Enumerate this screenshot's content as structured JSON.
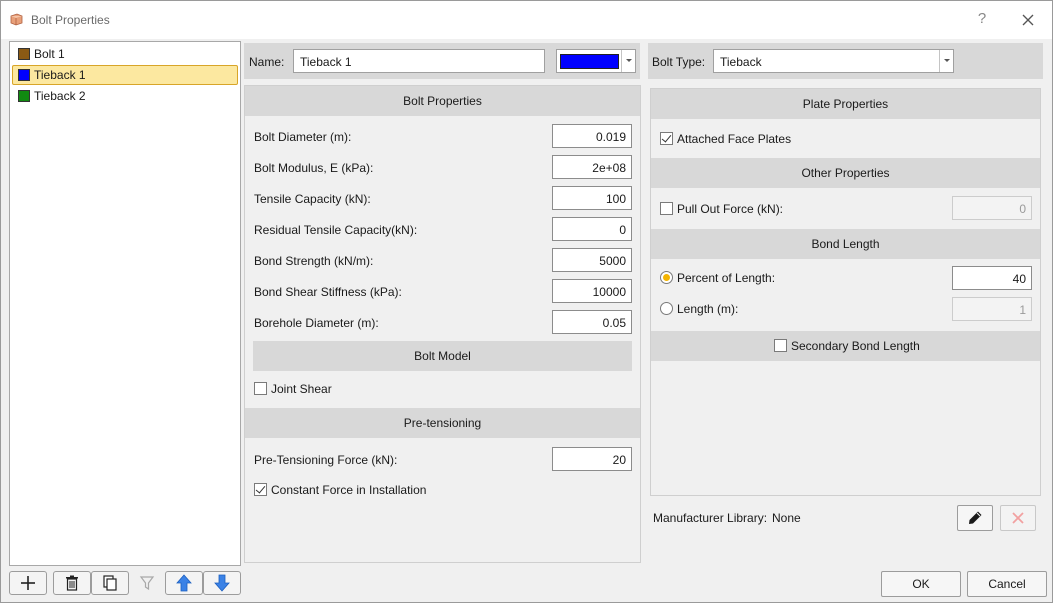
{
  "window": {
    "title": "Bolt Properties",
    "help_label": "?"
  },
  "bolt_list": [
    {
      "label": "Bolt 1",
      "color": "#8b5a14",
      "selected": false
    },
    {
      "label": "Tieback 1",
      "color": "#0000ff",
      "selected": true
    },
    {
      "label": "Tieback 2",
      "color": "#118a11",
      "selected": false
    }
  ],
  "name_bar": {
    "label": "Name:",
    "value": "Tieback 1",
    "color": "#0000ff"
  },
  "type_bar": {
    "label": "Bolt Type:",
    "value": "Tieback"
  },
  "bolt_properties": {
    "header": "Bolt Properties",
    "fields": [
      {
        "label": "Bolt Diameter (m):",
        "value": "0.019"
      },
      {
        "label": "Bolt Modulus, E (kPa):",
        "value": "2e+08"
      },
      {
        "label": "Tensile Capacity (kN):",
        "value": "100"
      },
      {
        "label": "Residual Tensile Capacity(kN):",
        "value": "0"
      },
      {
        "label": "Bond Strength (kN/m):",
        "value": "5000"
      },
      {
        "label": "Bond Shear Stiffness (kPa):",
        "value": "10000"
      },
      {
        "label": "Borehole Diameter (m):",
        "value": "0.05"
      }
    ]
  },
  "bolt_model": {
    "header": "Bolt Model",
    "joint_shear_label": "Joint Shear",
    "joint_shear_checked": false
  },
  "pretensioning": {
    "header": "Pre-tensioning",
    "force_label": "Pre-Tensioning Force (kN):",
    "force_value": "20",
    "constant_label": "Constant Force in Installation",
    "constant_checked": true
  },
  "plate_properties": {
    "header": "Plate Properties",
    "attached_label": "Attached Face Plates",
    "attached_checked": true
  },
  "other_properties": {
    "header": "Other Properties",
    "pullout_label": "Pull Out Force (kN):",
    "pullout_value": "0",
    "pullout_checked": false
  },
  "bond_length": {
    "header": "Bond Length",
    "percent_label": "Percent of Length:",
    "percent_value": "40",
    "length_label": "Length (m):",
    "length_value": "1",
    "selected": "percent"
  },
  "secondary_bond": {
    "label": "Secondary Bond Length",
    "checked": false
  },
  "manufacturer": {
    "label": "Manufacturer Library:",
    "value": "None"
  },
  "buttons": {
    "ok": "OK",
    "cancel": "Cancel"
  },
  "toolbar_icons": [
    "add-icon",
    "delete-icon",
    "copy-icon",
    "filter-icon",
    "move-up-icon",
    "move-down-icon"
  ]
}
